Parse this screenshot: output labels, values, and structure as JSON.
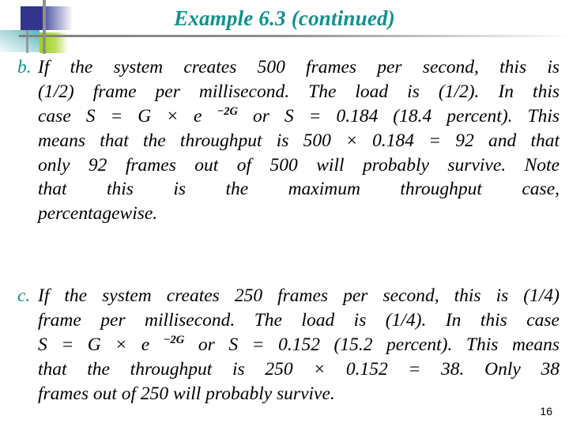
{
  "slide": {
    "title": "Example 6.3 (continued)",
    "page_number": "16",
    "accent_color": "#11918d",
    "title_color": "#11918d",
    "body_color": "#000000",
    "background_color": "#ffffff"
  },
  "decoration": {
    "navy_square_color": "#33348c",
    "teal_square_color": "#4fb3b8",
    "green_square_color": "#9fd01a",
    "rule_color": "#8d8f92"
  },
  "content": {
    "paragraph_b": {
      "marker": "b.",
      "lines": [
        "If the system creates 500 frames per second, this is",
        "(1/2) frame per millisecond. The load is (1/2). In this",
        "case S = G × e ",
        " or S = 0.184 (18.4 percent). This",
        "means that the throughput is 500 × 0.184 = 92 and that",
        "only 92 frames out of 500 will probably survive. Note",
        "that this is the maximum throughput case,",
        "percentagewise."
      ],
      "exponent": "−2G",
      "full_text": "If the system creates 500 frames per second, this is (1/2) frame per millisecond. The load is (1/2). In this case S = G × e −2G or S = 0.184 (18.4 percent). This means that the throughput is 500 × 0.184 = 92 and that only 92 frames out of 500 will probably survive. Note that this is the maximum throughput case, percentagewise."
    },
    "paragraph_c": {
      "marker": "c.",
      "lines": [
        "If the system creates 250 frames per second, this is (1/4)",
        "frame per millisecond. The load is (1/4). In this case",
        "S = G × e ",
        " or S = 0.152 (15.2 percent). This means",
        "that the throughput is 250 × 0.152 = 38. Only 38",
        "frames out of 250 will probably survive."
      ],
      "exponent": "−2G",
      "full_text": "If the system creates 250 frames per second, this is (1/4) frame per millisecond. The load is (1/4). In this case S = G × e −2G or S = 0.152 (15.2 percent). This means that the throughput is 250 × 0.152 = 38. Only 38 frames out of 250 will probably survive."
    }
  }
}
